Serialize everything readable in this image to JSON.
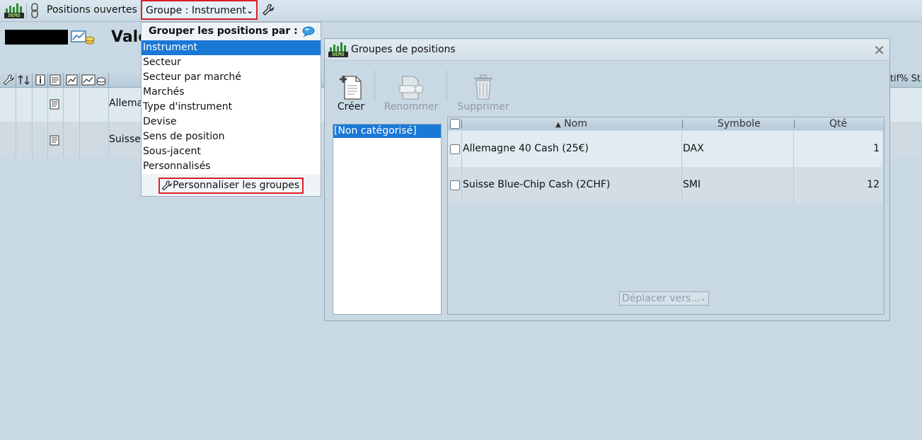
{
  "toolbar": {
    "logo_tag": "DEMO",
    "open_positions": "Positions ouvertes",
    "group_dropdown": "Groupe : Instrument"
  },
  "background": {
    "title": "Valo",
    "right_header": "tif% St",
    "rows": [
      {
        "name": "Allema"
      },
      {
        "name": "Suisse"
      }
    ]
  },
  "menu": {
    "header": "Grouper les positions par :",
    "items": [
      {
        "label": "Instrument",
        "selected": true
      },
      {
        "label": "Secteur",
        "selected": false
      },
      {
        "label": "Secteur par marché",
        "selected": false
      },
      {
        "label": "Marchés",
        "selected": false
      },
      {
        "label": "Type d'instrument",
        "selected": false
      },
      {
        "label": "Devise",
        "selected": false
      },
      {
        "label": "Sens de position",
        "selected": false
      },
      {
        "label": "Sous-jacent",
        "selected": false
      },
      {
        "label": "Personnalisés",
        "selected": false
      }
    ],
    "customize": "Personnaliser les groupes"
  },
  "dialog": {
    "title": "Groupes de positions",
    "logo_tag": "DEMO",
    "toolbar": {
      "create": "Créer",
      "rename": "Renommer",
      "delete": "Supprimer"
    },
    "groups": [
      "[Non catégorisé]"
    ],
    "table": {
      "columns": {
        "name": "Nom",
        "symbol": "Symbole",
        "qty": "Qté"
      },
      "sort_indicator": "▲",
      "rows": [
        {
          "name": "Allemagne 40 Cash (25€)",
          "symbol": "DAX",
          "qty": "1"
        },
        {
          "name": "Suisse Blue-Chip Cash (2CHF)",
          "symbol": "SMI",
          "qty": "12"
        }
      ]
    },
    "move_to": "Déplacer vers..."
  },
  "colors": {
    "accent_selection": "#1a78d6",
    "highlight_border": "#d9202a",
    "background": "#c8d9e3"
  }
}
